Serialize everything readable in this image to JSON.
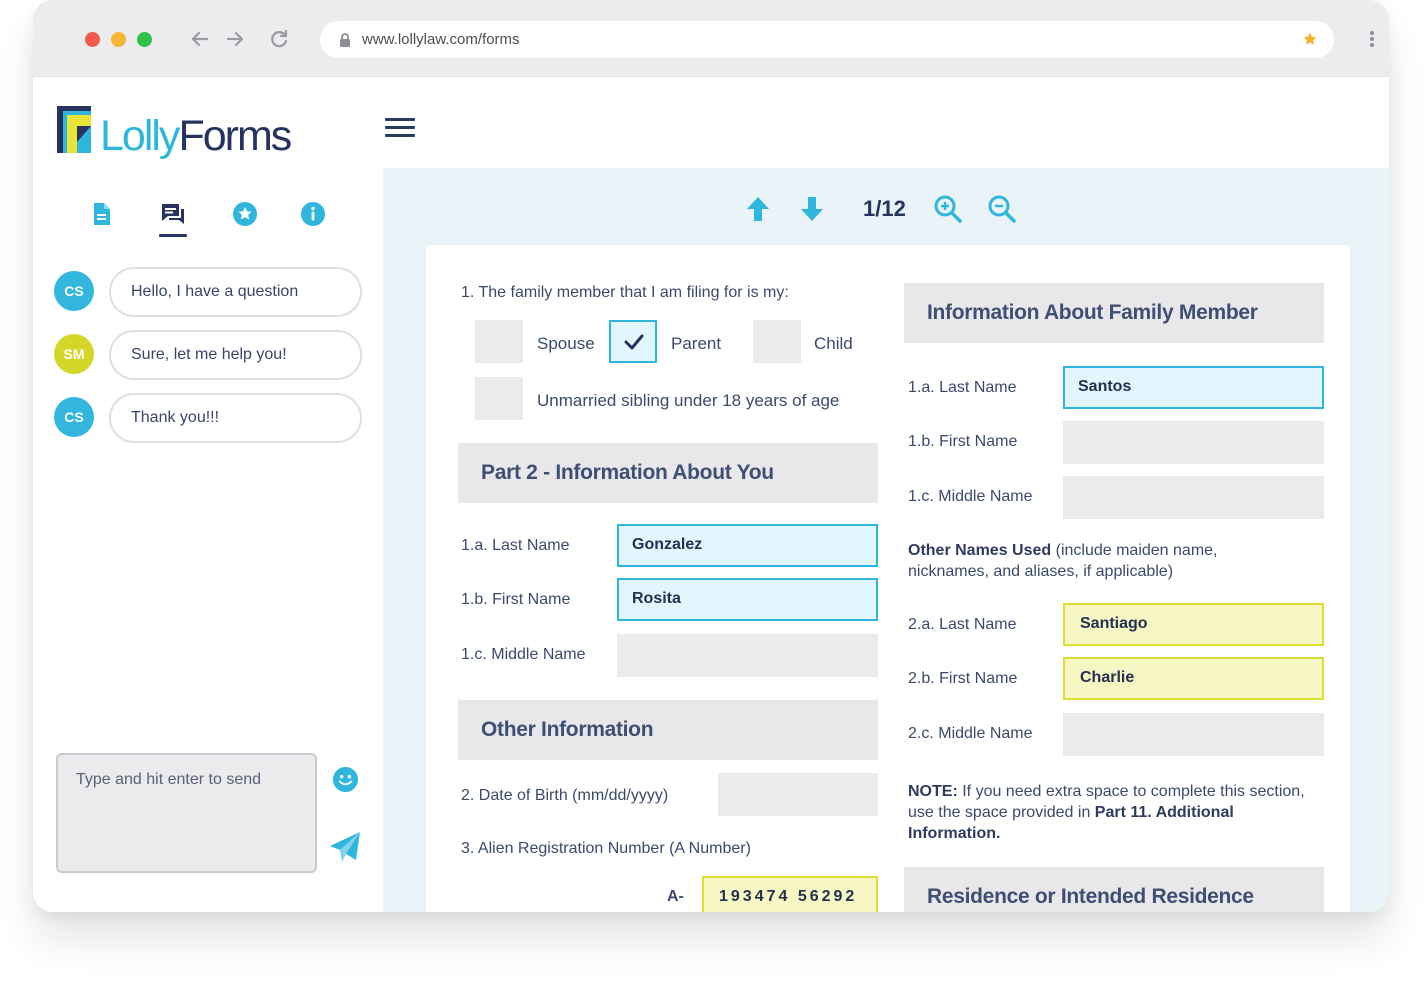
{
  "browser": {
    "url": "www.lollylaw.com/forms"
  },
  "brand": {
    "logo_lolly": "Lolly",
    "logo_forms": "Forms",
    "accent": "#2eb6dc",
    "navy": "#26335e"
  },
  "sidebar": {
    "tabs": [
      {
        "icon": "document-icon"
      },
      {
        "icon": "chat-icon",
        "active": true
      },
      {
        "icon": "star-icon"
      },
      {
        "icon": "info-icon"
      }
    ],
    "messages": [
      {
        "avatar": "CS",
        "text": "Hello, I have a question"
      },
      {
        "avatar": "SM",
        "text": "Sure, let me help you!"
      },
      {
        "avatar": "CS",
        "text": "Thank you!!!"
      }
    ],
    "compose_placeholder": "Type and hit enter to send"
  },
  "viewer": {
    "page_indicator": "1/12"
  },
  "form": {
    "q1": "1. The family member that I am filing for is my:",
    "options": [
      {
        "label": "Spouse",
        "checked": false
      },
      {
        "label": "Parent",
        "checked": true
      },
      {
        "label": "Child",
        "checked": false
      },
      {
        "label": "Unmarried sibling under 18 years of age",
        "checked": false
      }
    ],
    "part2": {
      "title": "Part 2 - Information About You",
      "last_name_label": "1.a. Last Name",
      "last_name": "Gonzalez",
      "first_name_label": "1.b. First Name",
      "first_name": "Rosita",
      "middle_name_label": "1.c. Middle Name",
      "middle_name": ""
    },
    "other": {
      "title": "Other Information",
      "dob_label": "2. Date of Birth (mm/dd/yyyy)",
      "dob": "",
      "alien_label": "3. Alien Registration Number (A Number)",
      "alien_prefix": "A-",
      "alien_number": "193474 56292"
    },
    "family": {
      "title": "Information About Family Member",
      "last_name_label": "1.a. Last Name",
      "last_name": "Santos",
      "first_name_label": "1.b. First Name",
      "first_name": "",
      "middle_name_label": "1.c. Middle Name",
      "middle_name": "",
      "other_names_bold": "Other Names Used",
      "other_names_rest": " (include maiden name, nicknames, and aliases, if applicable)",
      "other_last_label": "2.a. Last Name",
      "other_last": "Santiago",
      "other_first_label": "2.b. First Name",
      "other_first": "Charlie",
      "other_middle_label": "2.c. Middle Name",
      "other_middle": "",
      "note_bold": "NOTE:",
      "note_text": "  If you need extra space to complete this section, use the space provided in ",
      "note_ref": "Part 11. Additional Information."
    },
    "residence_title": "Residence or Intended Residence"
  }
}
